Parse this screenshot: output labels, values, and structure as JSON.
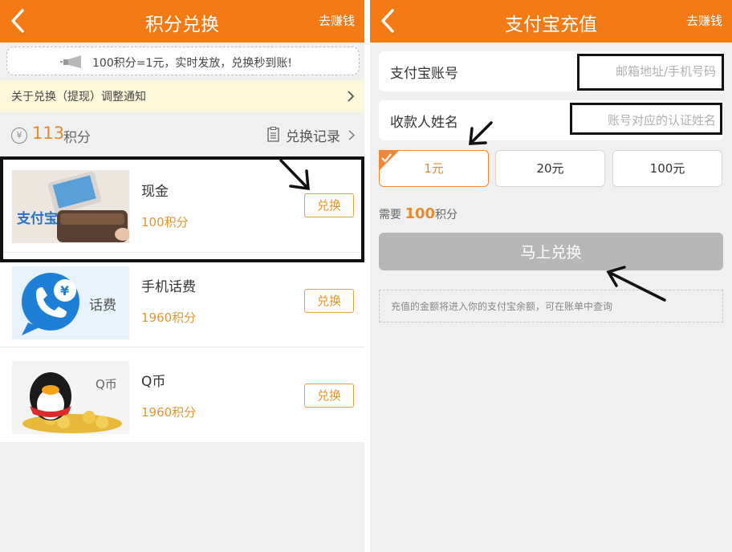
{
  "colors": {
    "brand": "#f47a14",
    "accent": "#e8892a",
    "notice_bg": "#fdf8d9",
    "disabled": "#b7b7b7"
  },
  "left": {
    "title": "积分兑换",
    "earn_link": "去赚钱",
    "notice": "100积分=1元，实时发放，兑换秒到账!",
    "announcement": "关于兑换（提现）调整通知",
    "points": {
      "icon_text": "¥",
      "value": "113",
      "unit": "积分"
    },
    "records_link": "兑换记录",
    "items": [
      {
        "name": "现金",
        "cost": "100积分",
        "button": "兑换",
        "thumb": "alipay-wallet",
        "thumb_text": "支付宝"
      },
      {
        "name": "手机话费",
        "cost": "1960积分",
        "button": "兑换",
        "thumb": "phone-bill",
        "thumb_text": "话费"
      },
      {
        "name": "Q币",
        "cost": "1960积分",
        "button": "兑换",
        "thumb": "qq-coins",
        "thumb_text": "Q币"
      }
    ]
  },
  "right": {
    "title": "支付宝充值",
    "earn_link": "去赚钱",
    "account": {
      "label": "支付宝账号",
      "placeholder": "邮箱地址/手机号码",
      "value": ""
    },
    "payee": {
      "label": "收款人姓名",
      "placeholder": "账号对应的认证姓名",
      "value": ""
    },
    "amounts": [
      {
        "label": "1元",
        "selected": true
      },
      {
        "label": "20元",
        "selected": false
      },
      {
        "label": "100元",
        "selected": false
      }
    ],
    "need": {
      "prefix": "需要",
      "value": "100",
      "unit": "积分"
    },
    "submit": "马上兑换",
    "hint": "充值的金额将进入你的支付宝余额，可在账单中查询"
  }
}
